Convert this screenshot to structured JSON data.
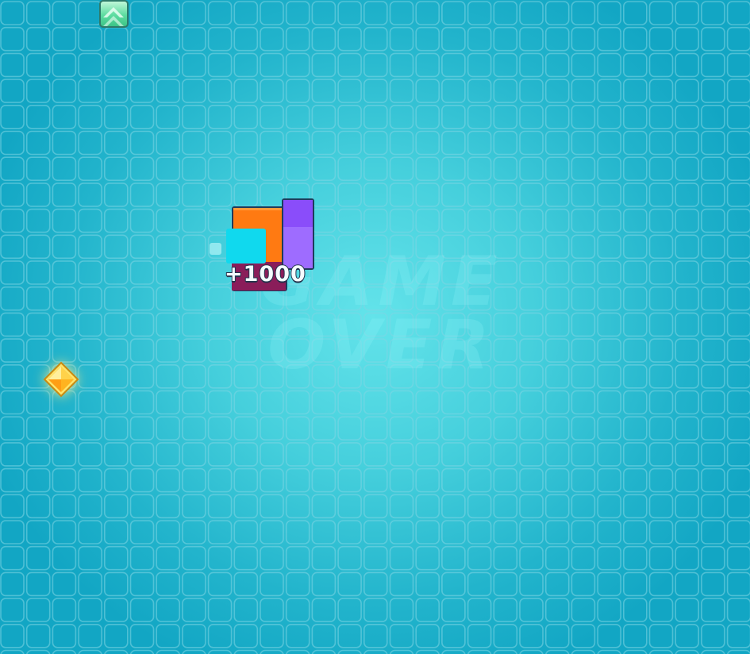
{
  "game": {
    "overlay_text": [
      "GAME",
      "OVER"
    ],
    "score_popup": "+1000"
  },
  "pieces": {
    "cleared_block_colors": [
      "#ff7a12",
      "#8a4dfa",
      "#10d9ee",
      "#8a1d5a"
    ],
    "green_gem_color": "#5ddca0",
    "yellow_gem_color": "#ffc233"
  },
  "icons": {
    "green_gem": "green-gem-icon",
    "yellow_gem": "yellow-diamond-icon"
  },
  "colors": {
    "board_center": "#63e3ea",
    "board_edge": "#12a6c4",
    "grid_line": "#7fd6e4"
  }
}
